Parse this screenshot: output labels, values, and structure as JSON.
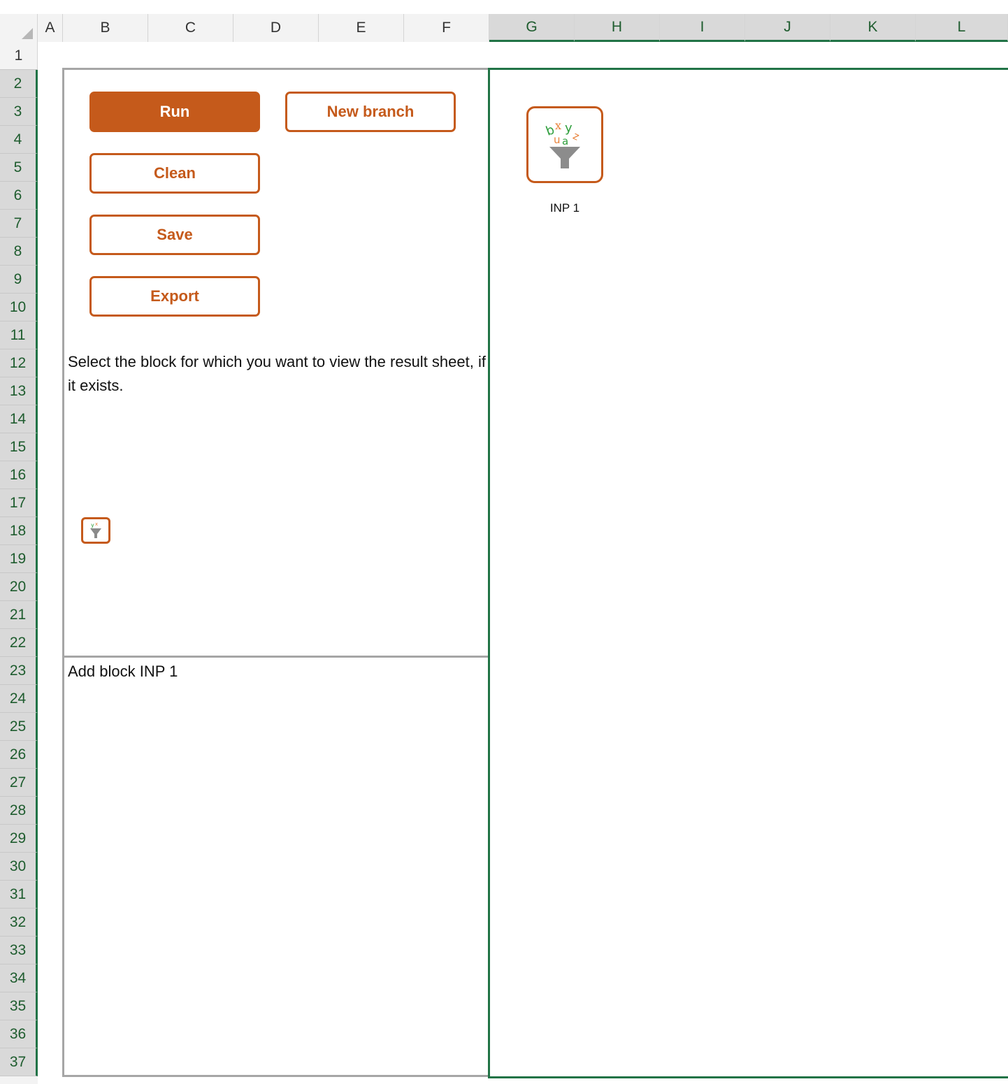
{
  "spreadsheet": {
    "columns": [
      "A",
      "B",
      "C",
      "D",
      "E",
      "F",
      "G",
      "H",
      "I",
      "J",
      "K",
      "L"
    ],
    "rows": [
      "1",
      "2",
      "3",
      "4",
      "5",
      "6",
      "7",
      "8",
      "9",
      "10",
      "11",
      "12",
      "13",
      "14",
      "15",
      "16",
      "17",
      "18",
      "19",
      "20",
      "21",
      "22",
      "23",
      "24",
      "25",
      "26",
      "27",
      "28",
      "29",
      "30",
      "31",
      "32",
      "33",
      "34",
      "35",
      "36",
      "37"
    ]
  },
  "toolbar": {
    "run_label": "Run",
    "new_branch_label": "New branch",
    "clean_label": "Clean",
    "save_label": "Save",
    "export_label": "Export"
  },
  "info": {
    "select_hint": "Select the block for which you want to view the result sheet, if it exists."
  },
  "log": {
    "message": "Add block INP 1"
  },
  "canvas": {
    "block_label": "INP 1",
    "block_icon": "funnel-icon"
  },
  "colors": {
    "accent": "#c55a1b",
    "selection": "#217346",
    "panel_border": "#a6a6a6"
  }
}
